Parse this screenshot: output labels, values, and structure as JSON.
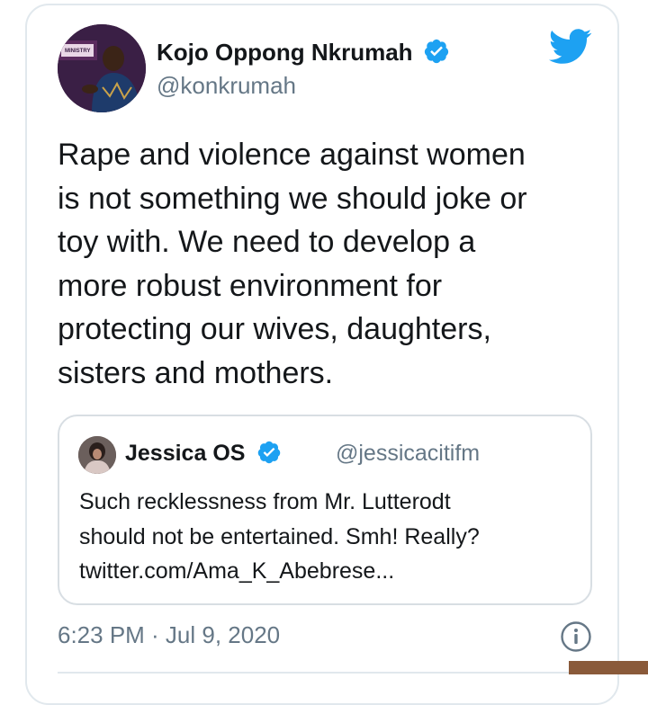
{
  "author": {
    "name": "Kojo Oppong Nkrumah",
    "handle": "@konkrumah",
    "avatar_icon": "profile-photo",
    "verified_icon": "verified-badge-icon"
  },
  "tweet": {
    "lines": [
      "Rape and violence against women",
      "is not something we should joke or",
      "toy with. We need to develop a",
      "more robust environment for",
      "protecting our wives, daughters,",
      "sisters and mothers."
    ],
    "timestamp": "6:23 PM · Jul 9, 2020"
  },
  "quoted_tweet": {
    "name": "Jessica OS",
    "handle": "@jessicacitifm",
    "lines": [
      "Such recklessness from Mr. Lutterodt",
      "should not be entertained. Smh! Really?"
    ],
    "link": "twitter.com/Ama_K_Abebrese..."
  },
  "icons": {
    "brand": "twitter-bird-icon",
    "info": "info-icon"
  },
  "colors": {
    "twitter_blue": "#1da1f2",
    "text_primary": "#14171a",
    "text_secondary": "#657786",
    "border": "#e1e8ed"
  }
}
